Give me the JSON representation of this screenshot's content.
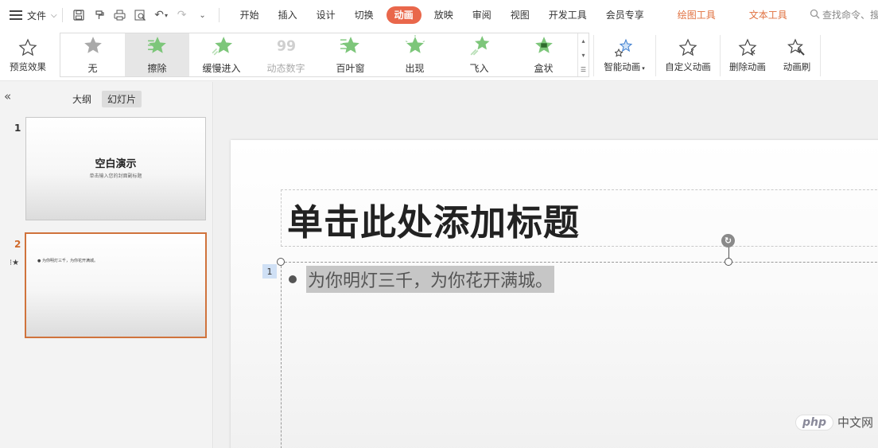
{
  "menubar": {
    "file_label": "文件",
    "tabs": [
      {
        "label": "开始",
        "state": "normal"
      },
      {
        "label": "插入",
        "state": "normal"
      },
      {
        "label": "设计",
        "state": "normal"
      },
      {
        "label": "切换",
        "state": "normal"
      },
      {
        "label": "动画",
        "state": "active"
      },
      {
        "label": "放映",
        "state": "normal"
      },
      {
        "label": "审阅",
        "state": "normal"
      },
      {
        "label": "视图",
        "state": "normal"
      },
      {
        "label": "开发工具",
        "state": "normal"
      },
      {
        "label": "会员专享",
        "state": "normal"
      },
      {
        "label": "绘图工具",
        "state": "contextual"
      },
      {
        "label": "文本工具",
        "state": "contextual"
      }
    ],
    "search_placeholder": "查找命令、搜",
    "active_color": "#e9674b",
    "contextual_color": "#e0703f"
  },
  "ribbon": {
    "preview_label": "预览效果",
    "gallery": [
      {
        "label": "无",
        "icon": "star-gray-icon",
        "selected": false,
        "disabled": false
      },
      {
        "label": "擦除",
        "icon": "wipe-star-icon",
        "selected": true,
        "disabled": false
      },
      {
        "label": "缓慢进入",
        "icon": "crawl-in-star-icon",
        "selected": false,
        "disabled": false
      },
      {
        "label": "动态数字",
        "icon": "dynamic-number-icon",
        "selected": false,
        "disabled": true
      },
      {
        "label": "百叶窗",
        "icon": "blinds-star-icon",
        "selected": false,
        "disabled": false
      },
      {
        "label": "出现",
        "icon": "appear-star-icon",
        "selected": false,
        "disabled": false
      },
      {
        "label": "飞入",
        "icon": "fly-in-star-icon",
        "selected": false,
        "disabled": false
      },
      {
        "label": "盒状",
        "icon": "box-star-icon",
        "selected": false,
        "disabled": false
      }
    ],
    "smart_label": "智能动画",
    "custom_label": "自定义动画",
    "delete_label": "删除动画",
    "painter_label": "动画刷",
    "effect_color": "#7dc67a"
  },
  "leftpane": {
    "outline_label": "大纲",
    "slides_label": "幻灯片",
    "slides": [
      {
        "number": "1",
        "title": "空白演示",
        "subtitle": "单击输入您的封面副标题"
      },
      {
        "number": "2",
        "body": "● 为你明灯三千，为你花开满城。"
      }
    ],
    "current_color": "#d0733c"
  },
  "editor": {
    "title": "单击此处添加标题",
    "anim_order": "1",
    "bullet": "为你明灯三千，为你花开满城。"
  },
  "watermark": {
    "logo": "php",
    "text": "中文网"
  }
}
